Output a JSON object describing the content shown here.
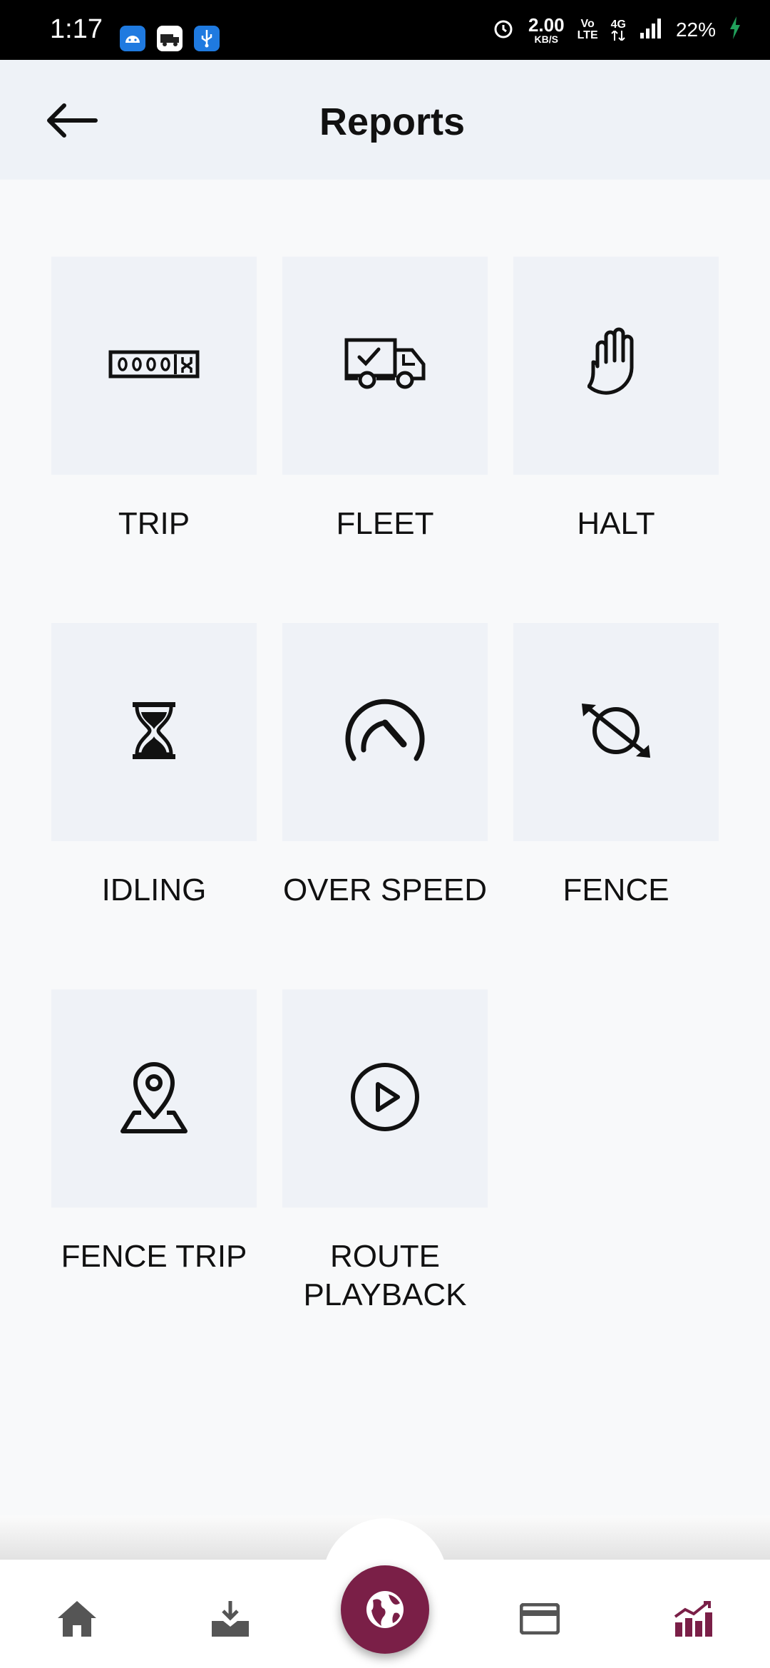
{
  "status_bar": {
    "time": "1:17",
    "net_speed": "2.00",
    "net_unit": "KB/S",
    "volte_top": "Vo",
    "volte_bottom": "LTE",
    "network": "4G",
    "battery": "22%"
  },
  "header": {
    "title": "Reports",
    "back_icon": "arrow-left-icon"
  },
  "reports": [
    {
      "label": "TRIP",
      "icon": "odometer-icon"
    },
    {
      "label": "FLEET",
      "icon": "truck-check-icon"
    },
    {
      "label": "HALT",
      "icon": "hand-icon"
    },
    {
      "label": "IDLING",
      "icon": "hourglass-icon"
    },
    {
      "label": "OVER SPEED",
      "icon": "speedometer-icon"
    },
    {
      "label": "FENCE",
      "icon": "fence-arrows-icon"
    },
    {
      "label": "FENCE TRIP",
      "icon": "map-pin-icon"
    },
    {
      "label": "ROUTE PLAYBACK",
      "icon": "play-circle-icon"
    }
  ],
  "bottom_nav": {
    "items": [
      "home-icon",
      "download-icon",
      "globe-icon",
      "card-icon",
      "chart-icon"
    ],
    "active": "chart-icon",
    "accent": "#7a1f47",
    "inactive_color": "#555555"
  }
}
